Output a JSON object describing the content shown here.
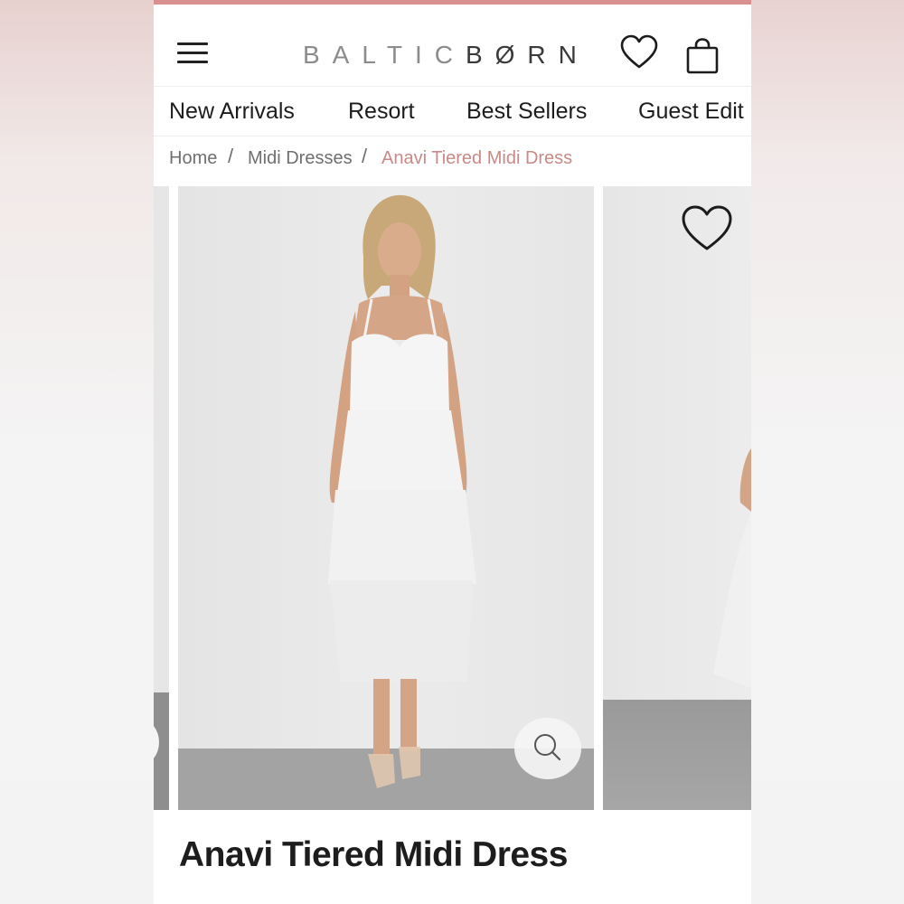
{
  "brand": {
    "logo_light": "BALTIC",
    "logo_dark": "BØRN",
    "accent_color": "#d9908f",
    "breadcrumb_active_color": "#c98a87"
  },
  "header": {
    "menu_icon": "hamburger-menu-icon",
    "wishlist_icon": "heart-icon",
    "cart_icon": "shopping-bag-icon"
  },
  "nav": {
    "items": [
      "New Arrivals",
      "Resort",
      "Best Sellers",
      "Guest Edit"
    ]
  },
  "breadcrumb": {
    "items": [
      "Home",
      "Midi Dresses",
      "Anavi Tiered Midi Dress"
    ],
    "separator": "/"
  },
  "gallery": {
    "zoom_icon": "magnifier-icon",
    "wishlist_icon": "heart-icon"
  },
  "product": {
    "title": "Anavi Tiered Midi Dress"
  }
}
